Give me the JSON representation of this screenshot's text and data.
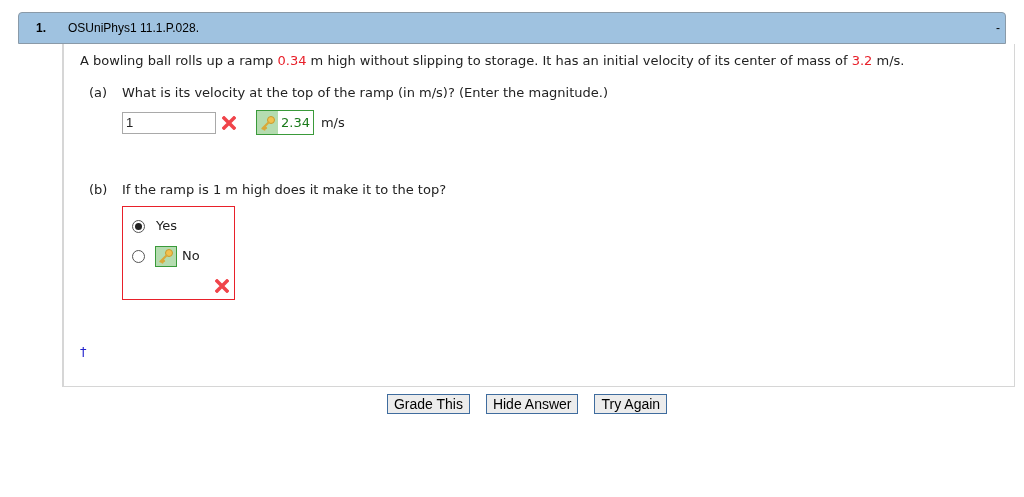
{
  "question": {
    "number": "1.",
    "title": "OSUniPhys1 11.1.P.028.",
    "collapse": "-"
  },
  "intro": [
    {
      "kind": "text",
      "text": "A bowling ball rolls up a ramp "
    },
    {
      "kind": "value",
      "text": "0.34"
    },
    {
      "kind": "text",
      "text": " m high without slipping to storage. It has an initial velocity of its center of mass of "
    },
    {
      "kind": "value",
      "text": "3.2"
    },
    {
      "kind": "text",
      "text": " m/s."
    }
  ],
  "parts": [
    {
      "kind": "numeric",
      "label": "(a)",
      "prompt": "What is its velocity at the top of the ramp (in m/s)? (Enter the magnitude.)",
      "value": "1",
      "correct": false,
      "key": "2.34",
      "unit": "m/s"
    },
    {
      "kind": "choice",
      "label": "(b)",
      "prompt": "If the ramp is 1 m high does it make it to the top?",
      "correct": false,
      "options": [
        {
          "label": "Yes",
          "selected": true,
          "is_key": false
        },
        {
          "label": "No",
          "selected": false,
          "is_key": true
        }
      ]
    }
  ],
  "footnote": "†",
  "buttons": [
    "Grade This",
    "Hide Answer",
    "Try Again"
  ]
}
